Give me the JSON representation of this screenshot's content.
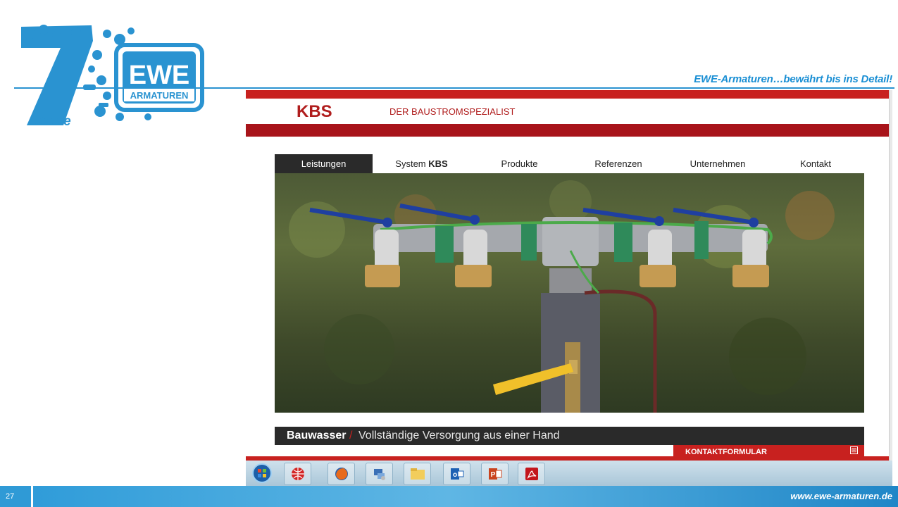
{
  "slide": {
    "slogan": "EWE-Armaturen…bewährt bis ins Detail!",
    "page_number": "27",
    "url": "www.ewe-armaturen.de"
  },
  "logo": {
    "badge_top": "EWE",
    "badge_bottom": "ARMATUREN",
    "anniversary_text": "Jahre"
  },
  "website": {
    "brand": "KBS",
    "tagline": "DER BAUSTROMSPEZIALIST",
    "nav": [
      {
        "label": "Leistungen",
        "bold": "",
        "active": true
      },
      {
        "label": "System ",
        "bold": "KBS",
        "active": false
      },
      {
        "label": "Produkte",
        "bold": "",
        "active": false
      },
      {
        "label": "Referenzen",
        "bold": "",
        "active": false
      },
      {
        "label": "Unternehmen",
        "bold": "",
        "active": false
      },
      {
        "label": "Kontakt",
        "bold": "",
        "active": false
      }
    ],
    "caption_strong": "Bauwasser",
    "caption_separator": "/",
    "caption_text": "Vollständige Versorgung aus einer Hand",
    "contact_label": "KONTAKTFORMULAR",
    "contact_plus": "⊞"
  },
  "taskbar": {
    "items": [
      "windows-start-icon",
      "globe-icon",
      "firefox-icon",
      "network-icon",
      "folder-icon",
      "outlook-icon",
      "powerpoint-icon",
      "acrobat-icon"
    ]
  },
  "colors": {
    "brand_red": "#c8211f",
    "brand_blue": "#1a8fd4"
  }
}
